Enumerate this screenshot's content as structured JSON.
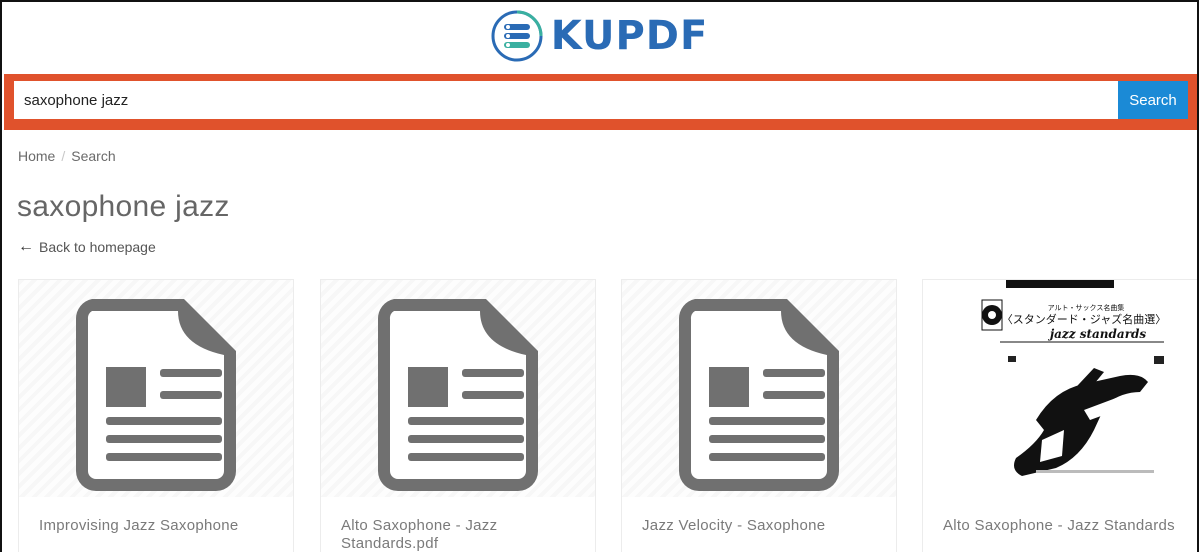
{
  "logo": {
    "text": "KUPDF",
    "icon": "kupdf-logo-icon",
    "color": "#2a6bb5"
  },
  "search": {
    "query": "saxophone jazz",
    "button_label": "Search",
    "band_color": "#e0522c",
    "button_color": "#1b8ad6"
  },
  "breadcrumb": {
    "home": "Home",
    "separator": "/",
    "current": "Search"
  },
  "page_title": "saxophone jazz",
  "back_link": {
    "icon": "arrow-left-icon",
    "label": "Back to homepage"
  },
  "results": [
    {
      "title": "Improvising Jazz Saxophone",
      "thumbnail": "document-icon"
    },
    {
      "title": "Alto Saxophone - Jazz Standards.pdf",
      "thumbnail": "document-icon"
    },
    {
      "title": "Jazz Velocity - Saxophone",
      "thumbnail": "document-icon"
    },
    {
      "title": "Alto Saxophone - Jazz Standards",
      "thumbnail": "book-cover-image",
      "cover_text": {
        "line1": "アルト・サックス名曲集",
        "line2": "〈スタンダード・ジャズ名曲選〉",
        "line3": "jazz standards"
      }
    }
  ]
}
